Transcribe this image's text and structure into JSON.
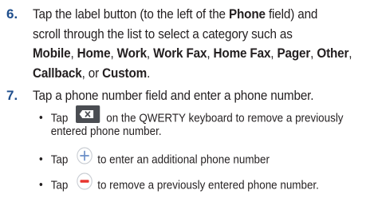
{
  "step6": {
    "number": "6.",
    "line1_pre": "Tap the label button (to the left of the ",
    "line1_bold": "Phone",
    "line1_post": " field) and",
    "line2": "scroll through the list to select a category such as",
    "line3_parts": [
      "Mobile",
      ", ",
      "Home",
      ", ",
      "Work",
      ", ",
      "Work Fax",
      ", ",
      "Home Fax",
      ", ",
      "Pager",
      ", ",
      "Other",
      ","
    ],
    "line4_b1": "Callback",
    "line4_mid": ", or ",
    "line4_b2": "Custom",
    "line4_end": "."
  },
  "step7": {
    "number": "7.",
    "text": "Tap a phone number field and enter a phone number."
  },
  "bullets": {
    "dot": "•",
    "b1_pre": "Tap",
    "b1_post": "on the QWERTY keyboard to remove a previously",
    "b1_line2": "entered phone number.",
    "b2_pre": "Tap",
    "b2_post": "to enter an additional phone number",
    "b3_pre": "Tap",
    "b3_post": "to remove a previously entered phone number."
  },
  "icons": {
    "delete_key": "backspace-key-icon",
    "add": "plus-circle-icon",
    "remove": "minus-circle-icon",
    "remove_color": "#e8352f",
    "add_color": "#6a8ec7",
    "step_number_color": "#1f4e8c"
  }
}
